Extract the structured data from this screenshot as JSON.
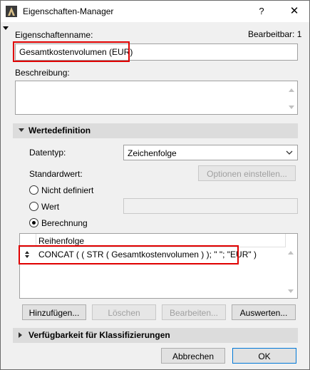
{
  "window": {
    "title": "Eigenschaften-Manager",
    "help": "?",
    "close": "✕"
  },
  "property": {
    "name_label": "Eigenschaftenname:",
    "editable_label": "Bearbeitbar: 1",
    "name_value": "Gesamtkostenvolumen (EUR)",
    "description_label": "Beschreibung:",
    "description_value": ""
  },
  "value_definition": {
    "header": "Wertedefinition",
    "datatype_label": "Datentyp:",
    "datatype_value": "Zeichenfolge",
    "default_label": "Standardwert:",
    "options_button": "Optionen einstellen...",
    "radio_undefined": "Nicht definiert",
    "radio_value": "Wert",
    "radio_calc": "Berechnung",
    "selected_radio": "Berechnung",
    "list_header": "Reihenfolge",
    "formula": "CONCAT ( ( STR ( Gesamtkostenvolumen ) ); \" \"; \"EUR\" )",
    "buttons": {
      "add": "Hinzufügen...",
      "delete": "Löschen",
      "edit": "Bearbeiten...",
      "evaluate": "Auswerten..."
    }
  },
  "availability": {
    "header": "Verfügbarkeit für Klassifizierungen"
  },
  "footer": {
    "cancel": "Abbrechen",
    "ok": "OK"
  }
}
